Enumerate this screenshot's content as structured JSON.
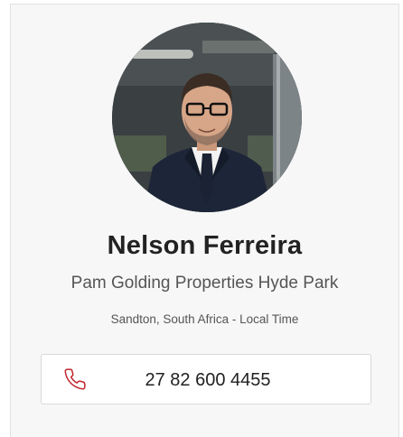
{
  "agent": {
    "name": "Nelson Ferreira",
    "company": "Pam Golding Properties Hyde Park",
    "location": "Sandton, South Africa - Local Time",
    "phone": "27 82 600 4455"
  },
  "colors": {
    "card_background": "#f7f7f7",
    "phone_icon": "#c0272d",
    "name_text": "#222222",
    "secondary_text": "#555555"
  },
  "icons": {
    "phone": "phone-icon"
  }
}
